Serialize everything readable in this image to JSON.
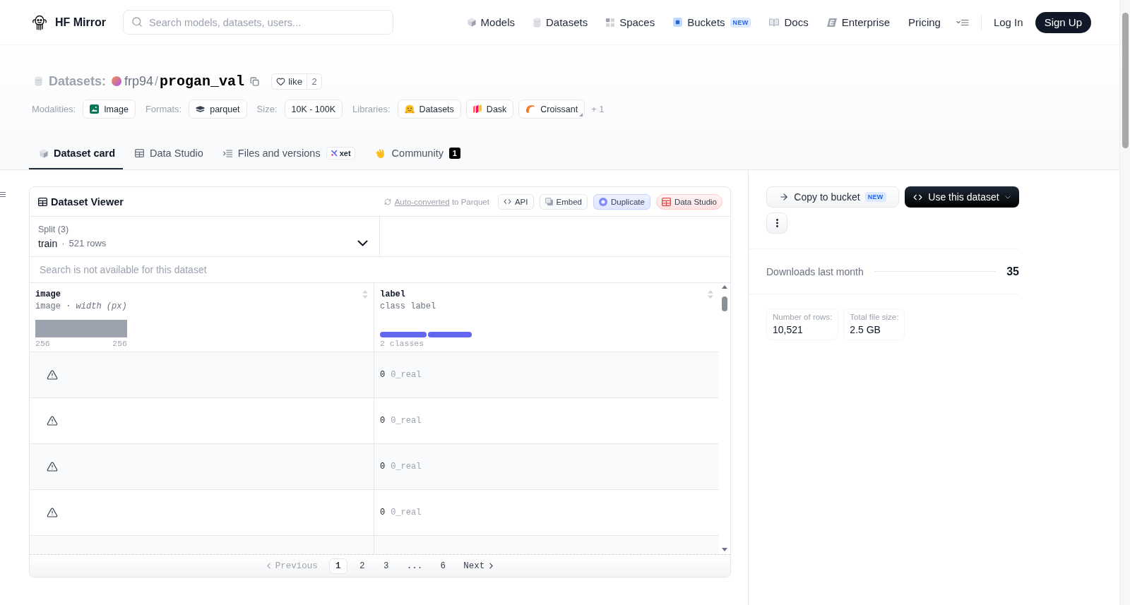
{
  "header": {
    "brand": "HF Mirror",
    "search": {
      "placeholder": "Search models, datasets, users..."
    },
    "nav": [
      {
        "label": "Models"
      },
      {
        "label": "Datasets"
      },
      {
        "label": "Spaces"
      },
      {
        "label": "Buckets",
        "badge": "NEW"
      },
      {
        "label": "Docs"
      },
      {
        "label": "Enterprise"
      },
      {
        "label": "Pricing"
      }
    ],
    "login": "Log In",
    "signup": "Sign Up"
  },
  "repo": {
    "type": "Datasets:",
    "owner": "frp94",
    "separator": "/",
    "name": "progan_val",
    "like": {
      "label": "like",
      "count": "2"
    }
  },
  "tag_groups": [
    {
      "label": "Modalities:",
      "tags": [
        "Image"
      ]
    },
    {
      "label": "Formats:",
      "tags": [
        "parquet"
      ]
    },
    {
      "label": "Size:",
      "tags": [
        "10K - 100K"
      ]
    },
    {
      "label": "Libraries:",
      "tags": [
        "Datasets",
        "Dask",
        "Croissant"
      ],
      "more": "+ 1"
    }
  ],
  "tabs": [
    {
      "label": "Dataset card",
      "selected": true
    },
    {
      "label": "Data Studio",
      "selected": false
    },
    {
      "label": "Files and versions",
      "selected": false,
      "badge": "xet"
    },
    {
      "label": "Community",
      "selected": false,
      "count": "1"
    }
  ],
  "viewer": {
    "title": "Dataset Viewer",
    "conversion": {
      "link": "Auto-converted",
      "text": "to Parquet"
    },
    "actions": [
      {
        "label": "API",
        "kind": "code"
      },
      {
        "label": "Embed",
        "kind": "embed"
      },
      {
        "label": "Duplicate",
        "kind": "duplicate"
      },
      {
        "label": "Data Studio",
        "kind": "studio"
      }
    ],
    "split": {
      "label": "Split (3)",
      "value": "train",
      "separator": "·",
      "detail": "521 rows"
    },
    "search": {
      "placeholder": "Search is not available for this dataset"
    },
    "columns": [
      {
        "name": "image",
        "subtitle": "image · *width (px)*",
        "kind": "histogram",
        "min": "256",
        "max": "256"
      },
      {
        "name": "label",
        "subtitle": "class label",
        "kind": "classes",
        "summary": "2 classes"
      }
    ],
    "rows": [
      {
        "image_error": true,
        "label": "0",
        "class_name": "0_real"
      },
      {
        "image_error": true,
        "label": "0",
        "class_name": "0_real"
      },
      {
        "image_error": true,
        "label": "0",
        "class_name": "0_real"
      },
      {
        "image_error": true,
        "label": "0",
        "class_name": "0_real"
      }
    ],
    "pagination": {
      "previous": {
        "label": "Previous",
        "disabled": true
      },
      "pages": [
        {
          "label": "1",
          "kind": "page",
          "selected": true
        },
        {
          "label": "2",
          "kind": "page",
          "selected": false
        },
        {
          "label": "3",
          "kind": "page",
          "selected": false
        },
        {
          "label": "...",
          "kind": "ellipsis",
          "selected": false
        },
        {
          "label": "6",
          "kind": "page",
          "selected": false
        }
      ],
      "next": {
        "label": "Next",
        "disabled": false
      }
    }
  },
  "sidebar": {
    "copy_button": {
      "label": "Copy to bucket",
      "badge": "NEW"
    },
    "use_button": "Use this dataset",
    "downloads": {
      "label": "Downloads last month",
      "value": "35"
    },
    "stats": [
      {
        "label": "Number of rows:",
        "value": "10,521"
      },
      {
        "label": "Total file size:",
        "value": "2.5 GB"
      }
    ]
  }
}
